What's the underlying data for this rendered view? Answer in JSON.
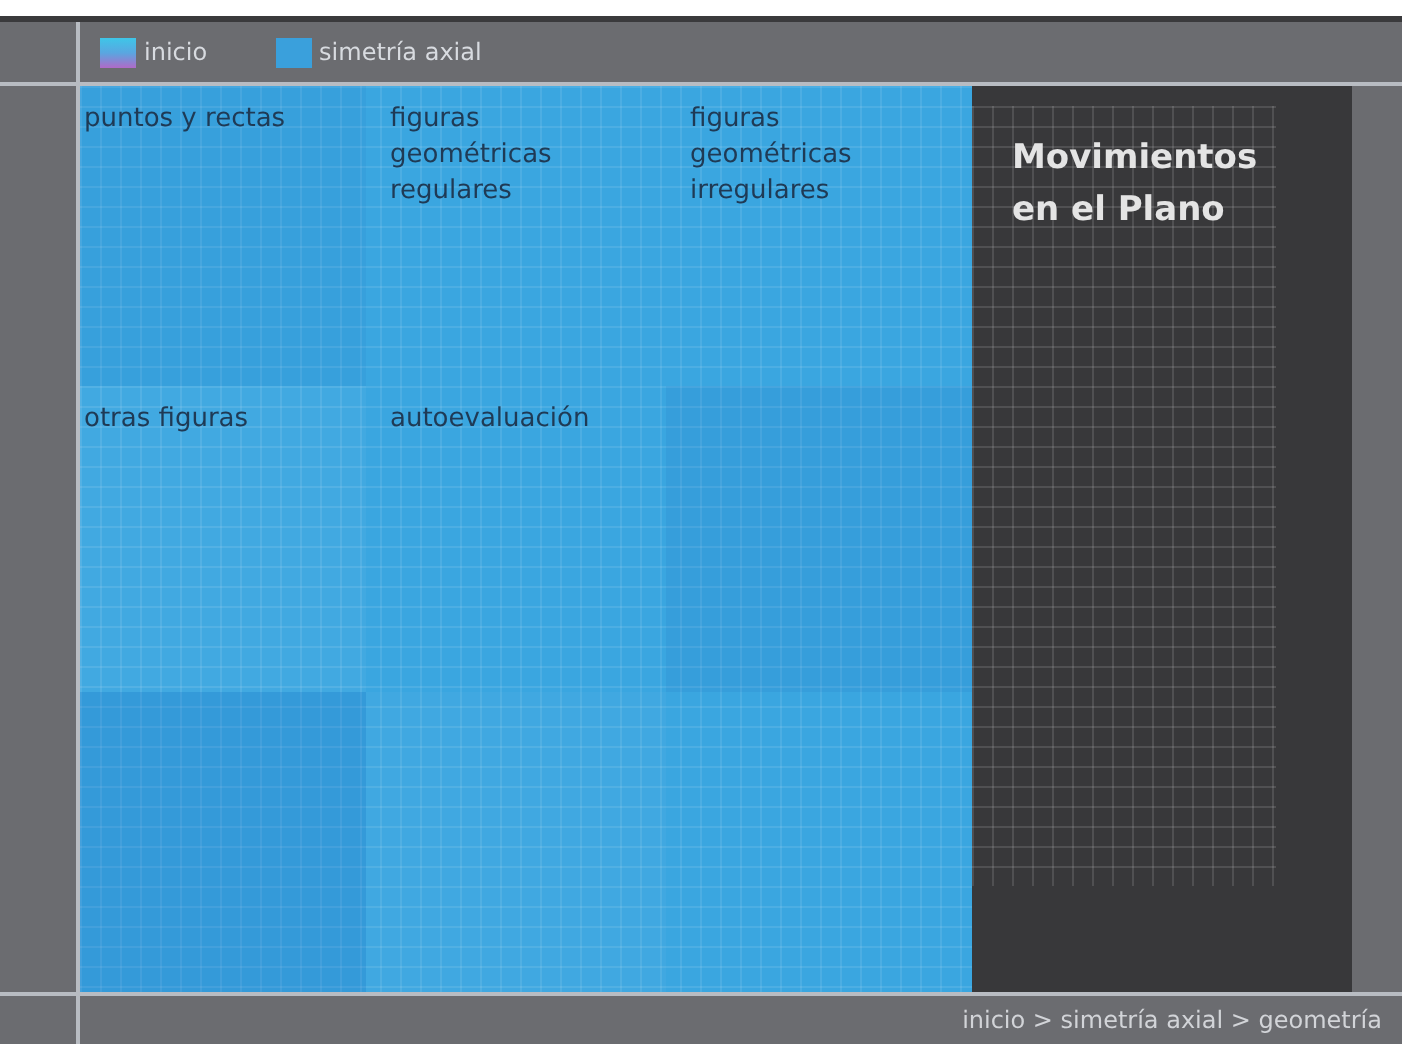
{
  "top_nav": [
    {
      "label": "inicio",
      "kind": "home"
    },
    {
      "label": "simetría axial",
      "kind": "section"
    }
  ],
  "tiles": [
    {
      "label": "puntos y rectas"
    },
    {
      "label": "figuras geométricas regulares"
    },
    {
      "label": "figuras geométricas irregulares"
    },
    {
      "label": "otras figuras"
    },
    {
      "label": "autoevaluación"
    }
  ],
  "panel": {
    "title": "Movimientos en el Plano"
  },
  "breadcrumb": "inicio > simetría axial > geometría"
}
